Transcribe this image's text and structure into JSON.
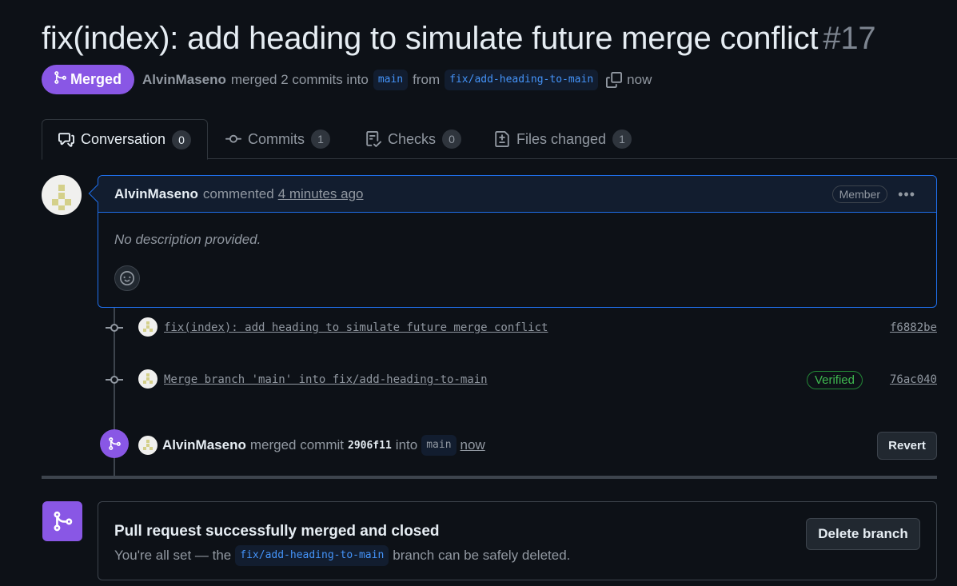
{
  "pr": {
    "title": "fix(index): add heading to simulate future merge conflict",
    "number": "#17",
    "status": "Merged",
    "author": "AlvinMaseno",
    "merged_text": "merged 2 commits into",
    "base_branch": "main",
    "from_text": "from",
    "head_branch": "fix/add-heading-to-main",
    "time": "now"
  },
  "tabs": [
    {
      "label": "Conversation",
      "count": "0",
      "icon": "conversation-icon"
    },
    {
      "label": "Commits",
      "count": "1",
      "icon": "commit-icon"
    },
    {
      "label": "Checks",
      "count": "0",
      "icon": "checklist-icon"
    },
    {
      "label": "Files changed",
      "count": "1",
      "icon": "file-diff-icon"
    }
  ],
  "comment": {
    "author": "AlvinMaseno",
    "action": "commented",
    "time": "4 minutes ago",
    "badge": "Member",
    "body": "No description provided."
  },
  "commits": [
    {
      "message": "fix(index): add heading to simulate future merge conflict",
      "sha": "f6882be",
      "verified": ""
    },
    {
      "message": "Merge branch 'main' into fix/add-heading-to-main",
      "sha": "76ac040",
      "verified": "Verified"
    }
  ],
  "merge_event": {
    "author": "AlvinMaseno",
    "text": "merged commit",
    "sha": "2906f11",
    "into": "into",
    "branch": "main",
    "time": "now",
    "revert_label": "Revert"
  },
  "merged_box": {
    "heading": "Pull request successfully merged and closed",
    "prefix": "You're all set — the",
    "branch": "fix/add-heading-to-main",
    "suffix": "branch can be safely deleted.",
    "delete_label": "Delete branch"
  },
  "colors": {
    "background": "#0d1117",
    "merged_purple": "#8957e5",
    "link_blue": "#4493f8",
    "verified_green": "#3fb950"
  }
}
